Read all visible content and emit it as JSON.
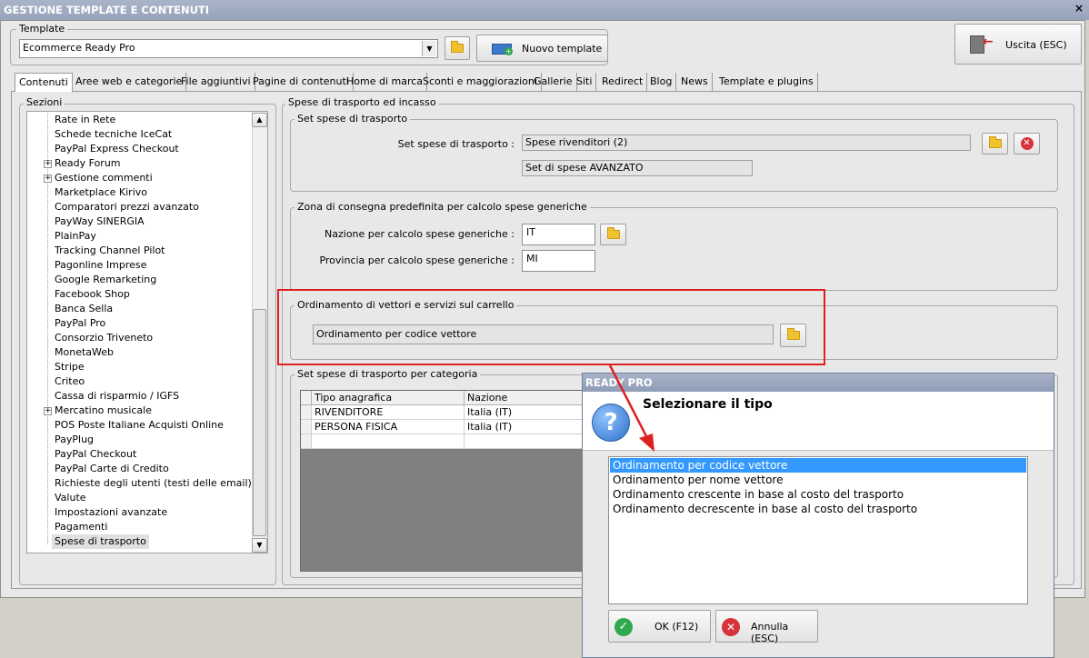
{
  "window": {
    "title": "GESTIONE TEMPLATE E CONTENUTI",
    "close": "×"
  },
  "template": {
    "group_label": "Template",
    "selected": "Ecommerce Ready Pro",
    "new_button": "Nuovo template",
    "exit_button": "Uscita (ESC)"
  },
  "tabs": [
    "Contenuti",
    "Aree web e categorie",
    "File aggiuntivi",
    "Pagine di contenuti",
    "Home di marca",
    "Sconti e maggiorazioni",
    "Gallerie",
    "Siti",
    "Redirect",
    "Blog",
    "News",
    "Template e plugins"
  ],
  "sections": {
    "label": "Sezioni",
    "items": [
      {
        "label": "Rate in Rete",
        "expandable": false
      },
      {
        "label": "Schede tecniche IceCat",
        "expandable": false
      },
      {
        "label": "PayPal Express Checkout",
        "expandable": false
      },
      {
        "label": "Ready Forum",
        "expandable": true
      },
      {
        "label": "Gestione commenti",
        "expandable": true
      },
      {
        "label": "Marketplace Kirivo",
        "expandable": false
      },
      {
        "label": "Comparatori prezzi avanzato",
        "expandable": false
      },
      {
        "label": "PayWay SINERGIA",
        "expandable": false
      },
      {
        "label": "PlainPay",
        "expandable": false
      },
      {
        "label": "Tracking Channel Pilot",
        "expandable": false
      },
      {
        "label": "Pagonline Imprese",
        "expandable": false
      },
      {
        "label": "Google Remarketing",
        "expandable": false
      },
      {
        "label": "Facebook Shop",
        "expandable": false
      },
      {
        "label": "Banca Sella",
        "expandable": false
      },
      {
        "label": "PayPal Pro",
        "expandable": false
      },
      {
        "label": "Consorzio Triveneto",
        "expandable": false
      },
      {
        "label": "MonetaWeb",
        "expandable": false
      },
      {
        "label": "Stripe",
        "expandable": false
      },
      {
        "label": "Criteo",
        "expandable": false
      },
      {
        "label": "Cassa di risparmio / IGFS",
        "expandable": false
      },
      {
        "label": "Mercatino musicale",
        "expandable": true
      },
      {
        "label": "POS Poste Italiane Acquisti Online",
        "expandable": false
      },
      {
        "label": "PayPlug",
        "expandable": false
      },
      {
        "label": "PayPal Checkout",
        "expandable": false
      },
      {
        "label": "PayPal Carte di Credito",
        "expandable": false
      },
      {
        "label": "Richieste degli utenti (testi delle email)",
        "expandable": false
      },
      {
        "label": "Valute",
        "expandable": false
      },
      {
        "label": "Impostazioni avanzate",
        "expandable": false
      },
      {
        "label": "Pagamenti",
        "expandable": false
      },
      {
        "label": "Spese di trasporto",
        "expandable": false,
        "selected": true
      }
    ]
  },
  "panel": {
    "title": "Spese di trasporto ed incasso",
    "set_group": {
      "title": "Set spese di trasporto",
      "field_label": "Set spese di trasporto :",
      "value": "Spese rivenditori (2)",
      "subvalue": "Set di spese AVANZATO"
    },
    "zone_group": {
      "title": "Zona di consegna predefinita per calcolo spese generiche",
      "nation_label": "Nazione per calcolo spese generiche :",
      "nation_value": "IT",
      "province_label": "Provincia per calcolo spese generiche :",
      "province_value": "MI"
    },
    "order_group": {
      "title": "Ordinamento di vettori e servizi sul carrello",
      "value": "Ordinamento per codice vettore"
    },
    "category_group": {
      "title": "Set spese di trasporto per categoria",
      "columns": [
        "Tipo anagrafica",
        "Nazione"
      ],
      "rows": [
        [
          "RIVENDITORE",
          "Italia (IT)"
        ],
        [
          "PERSONA FISICA",
          "Italia (IT)"
        ]
      ]
    }
  },
  "dialog": {
    "title": "READY PRO",
    "heading": "Selezionare il tipo",
    "options": [
      "Ordinamento per codice vettore",
      "Ordinamento per nome vettore",
      "Ordinamento crescente in base al costo del trasporto",
      "Ordinamento decrescente in base al costo del trasporto"
    ],
    "selected_index": 0,
    "ok_button": "OK (F12)",
    "cancel_button": "Annulla (ESC)"
  },
  "colors": {
    "highlight_box": "#e02020",
    "selection": "#3399ff",
    "title_bar": "#a9b4c9"
  }
}
